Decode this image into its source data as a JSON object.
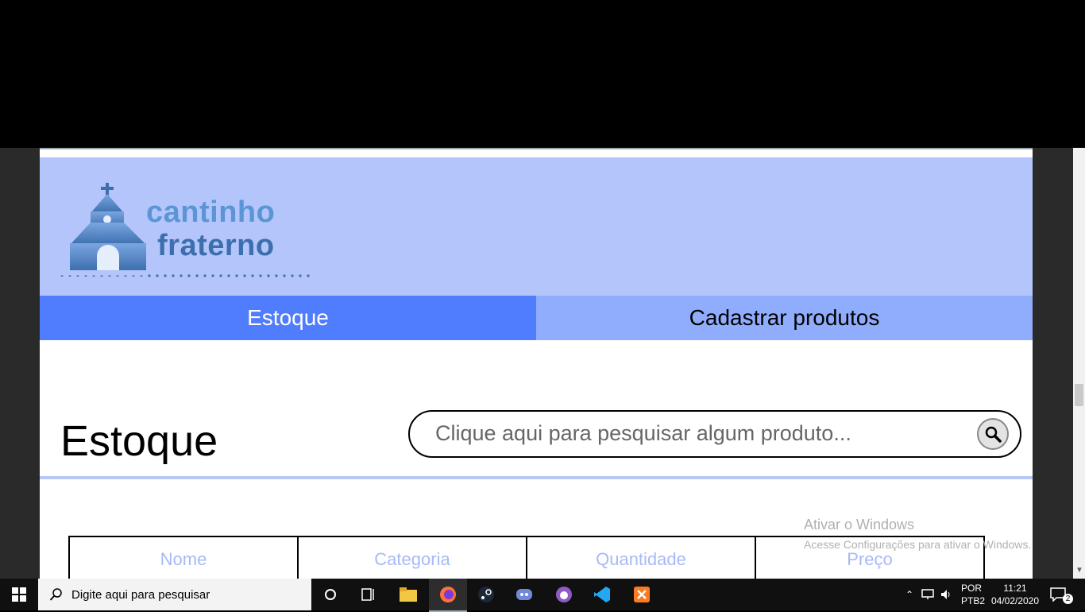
{
  "brand": {
    "line1": "cantinho",
    "line2": "fraterno"
  },
  "nav": {
    "tabs": [
      {
        "label": "Estoque"
      },
      {
        "label": "Cadastrar produtos"
      }
    ]
  },
  "main": {
    "title": "Estoque",
    "search": {
      "placeholder": "Clique aqui para pesquisar algum produto..."
    },
    "table": {
      "headers": [
        "Nome",
        "Categoria",
        "Quantidade",
        "Preço"
      ]
    }
  },
  "watermark": {
    "line1": "Ativar o Windows",
    "line2": "Acesse Configurações para ativar o Windows."
  },
  "taskbar": {
    "search_placeholder": "Digite aqui para pesquisar",
    "lang_top": "POR",
    "lang_bottom": "PTB2",
    "time": "11:21",
    "date": "04/02/2020",
    "notifications": "2"
  },
  "colors": {
    "header_bg": "#b3c5fa",
    "tab_active": "#507dfd",
    "tab_inactive": "#8fadfc",
    "table_header_text": "#a8b9f7"
  }
}
